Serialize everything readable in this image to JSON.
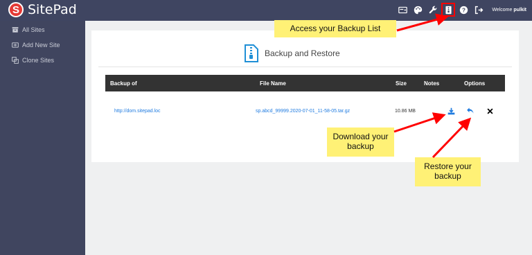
{
  "app": {
    "name": "SitePad",
    "logo_letter": "S"
  },
  "topbar": {
    "icons": [
      "backup-server-icon",
      "paint-palette-icon",
      "wrench-icon",
      "backup-list-icon",
      "help-icon",
      "logout-icon"
    ],
    "welcome_prefix": "Welcome",
    "username": "pulkit"
  },
  "sidebar": {
    "items": [
      {
        "label": "All Sites",
        "icon": "sites-icon"
      },
      {
        "label": "Add New Site",
        "icon": "add-site-icon"
      },
      {
        "label": "Clone Sites",
        "icon": "clone-icon"
      }
    ]
  },
  "main": {
    "title": "Backup and Restore",
    "table": {
      "columns": [
        "Backup of",
        "File Name",
        "Size",
        "Notes",
        "Options"
      ],
      "rows": [
        {
          "backup_of": "http://dom.sitepad.loc",
          "file_name": "sp.abcd_99999.2020-07-01_11-58-05.tar.gz",
          "size": "10.86 MB",
          "notes": ""
        }
      ]
    }
  },
  "callouts": {
    "backup_list": "Access your Backup List",
    "download": "Download your backup",
    "restore": "Restore your backup"
  },
  "colors": {
    "topbar": "#3f4561",
    "sidebar": "#40455f",
    "link": "#1f7be0",
    "callout": "#fff176",
    "arrow": "#ff0000"
  }
}
